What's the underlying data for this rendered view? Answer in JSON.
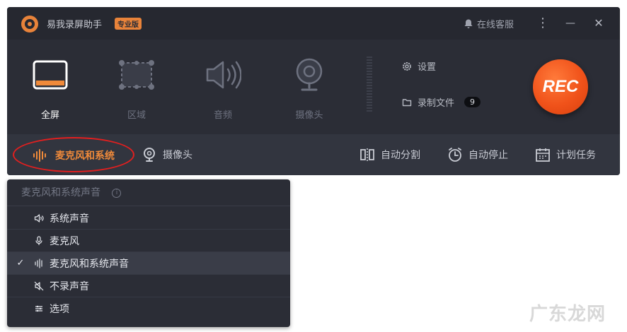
{
  "titlebar": {
    "app_title": "易我录屏助手",
    "edition": "专业版",
    "support": "在线客服",
    "menu_glyph": "⋮",
    "min_glyph": "—",
    "close_glyph": "✕"
  },
  "tools": [
    {
      "label": "全屏",
      "icon": "fullscreen-icon",
      "active": true
    },
    {
      "label": "区域",
      "icon": "region-icon",
      "active": false
    },
    {
      "label": "音频",
      "icon": "speaker-icon",
      "active": false
    },
    {
      "label": "摄像头",
      "icon": "webcam-icon",
      "active": false
    }
  ],
  "side_links": {
    "settings": "设置",
    "files": "录制文件",
    "files_count": "9"
  },
  "rec_label": "REC",
  "bottombar": {
    "mode": "麦克风和系统",
    "camera": "摄像头",
    "auto_split": "自动分割",
    "auto_stop": "自动停止",
    "schedule": "计划任务"
  },
  "dropdown": {
    "header": "麦克风和系统声音",
    "info_glyph": "i",
    "items": [
      {
        "label": "系统声音",
        "icon": "speaker-icon",
        "selected": false
      },
      {
        "label": "麦克风",
        "icon": "microphone-icon",
        "selected": false
      },
      {
        "label": "麦克风和系统声音",
        "icon": "waveform-icon",
        "selected": true
      },
      {
        "label": "不录声音",
        "icon": "mute-icon",
        "selected": false
      },
      {
        "label": "选项",
        "icon": "options-icon",
        "selected": false
      }
    ],
    "check_glyph": "✓"
  },
  "watermark": "广东龙网",
  "colors": {
    "accent": "#f08a3a",
    "rec": "#f0521a",
    "highlight_oval": "#e21f1f",
    "panel": "#2b2d36"
  }
}
